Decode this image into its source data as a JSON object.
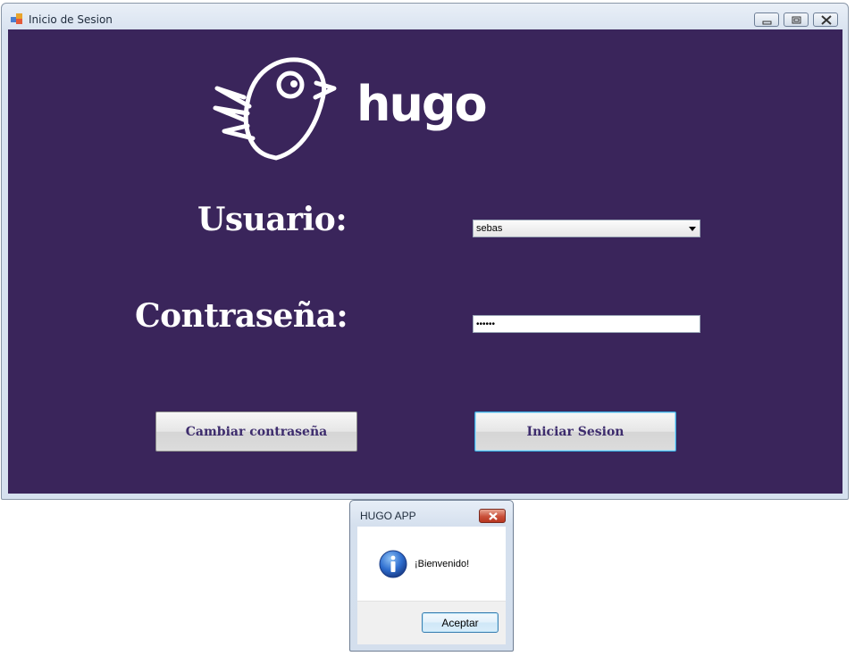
{
  "window": {
    "title": "Inicio de Sesion",
    "controls": [
      "minimize-icon",
      "restore-icon",
      "close-icon"
    ]
  },
  "logo": {
    "brand": "hugo",
    "icon": "bird-logo-icon"
  },
  "form": {
    "user_label": "Usuario:",
    "user_value": "sebas",
    "password_label": "Contraseña:",
    "password_value": "••••••"
  },
  "buttons": {
    "change_password": "Cambiar contraseña",
    "login": "Iniciar Sesion"
  },
  "dialog": {
    "title": "HUGO APP",
    "message": "¡Bienvenido!",
    "ok_label": "Aceptar",
    "icon": "info-icon"
  },
  "colors": {
    "panel_bg": "#3a255b",
    "button_text": "#3d2c6d",
    "focus_border": "#3aa3d8"
  }
}
